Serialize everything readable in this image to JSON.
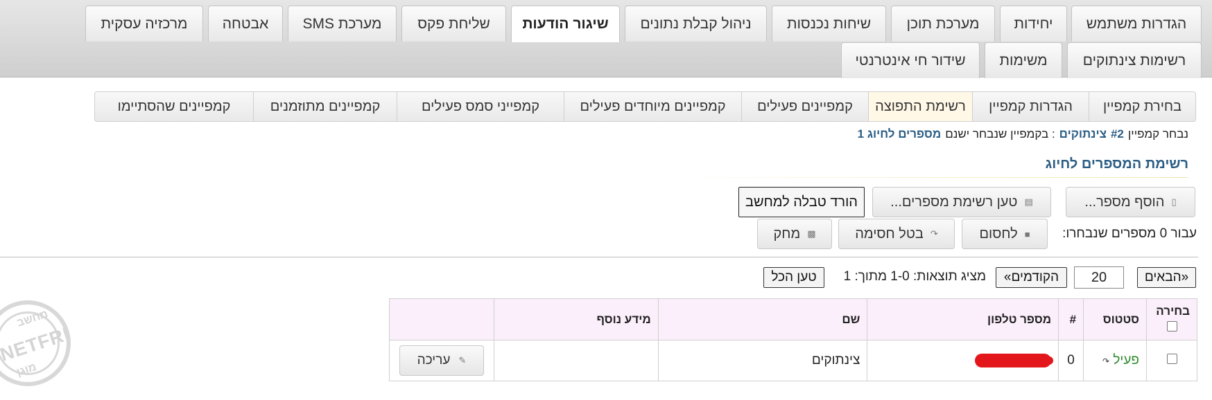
{
  "top_tabs": {
    "row1": [
      {
        "label": "הגדרות משתמש"
      },
      {
        "label": "יחידות"
      },
      {
        "label": "מערכת תוכן"
      },
      {
        "label": "שיחות נכנסות"
      },
      {
        "label": "ניהול קבלת נתונים"
      },
      {
        "label": "שיגור הודעות",
        "active": true
      },
      {
        "label": "שליחת פקס"
      },
      {
        "label": "מערכת SMS"
      },
      {
        "label": "אבטחה"
      },
      {
        "label": "מרכזיה עסקית"
      }
    ],
    "row2": [
      {
        "label": "רשימות צינתוקים"
      },
      {
        "label": "משימות"
      },
      {
        "label": "שידור חי אינטרנטי"
      }
    ]
  },
  "sub_tabs": [
    {
      "label": "בחירת קמפיין"
    },
    {
      "label": "הגדרות קמפיין"
    },
    {
      "label": "רשימת התפוצה",
      "active": true
    },
    {
      "label": "קמפיינים פעילים"
    },
    {
      "label": "קמפיינים מיוחדים פעילים"
    },
    {
      "label": "קמפייני סמס פעילים"
    },
    {
      "label": "קמפיינים מתוזמנים"
    },
    {
      "label": "קמפיינים שהסתיימו"
    }
  ],
  "info": {
    "prefix": "נבחר קמפיין",
    "campaign_id": "#2",
    "campaign_name": "צינתוקים",
    "middle": ": בקמפיין שנבחר ישנם",
    "count_text": "מספרים לחיוג 1"
  },
  "section": {
    "title": "רשימת המספרים לחיוג"
  },
  "actions": {
    "add_number": "הוסף מספר...",
    "load_list": "טען רשימת מספרים...",
    "download_table": "הורד טבלה למחשב",
    "selected_label": "עבור 0 מספרים שנבחרו:",
    "block": "לחסום",
    "unblock": "בטל חסימה",
    "delete": "מחק"
  },
  "pager": {
    "next": "«הבאים",
    "page_size": "20",
    "prev": "הקודמים»",
    "results_label": "מציג תוצאות: 1-0 מתוך: 1",
    "load_all": "טען הכל"
  },
  "table": {
    "headers": {
      "select": "בחירה",
      "status": "סטטוס",
      "index": "#",
      "phone": "מספר טלפון",
      "name": "שם",
      "extra": "מידע נוסף",
      "actions": ""
    },
    "rows": [
      {
        "status": "פעיל",
        "index": "0",
        "phone": "[redacted]",
        "name": "צינתוקים",
        "extra": "",
        "edit_label": "עריכה"
      }
    ]
  },
  "watermark": {
    "text": "NETFREE",
    "top": "מחשב",
    "bottom": "מוגן"
  },
  "colors": {
    "link_blue": "#2b5d84",
    "active_green": "#2e8b2e",
    "header_pink": "#fbeffb",
    "active_subtab": "#fff8e6"
  }
}
